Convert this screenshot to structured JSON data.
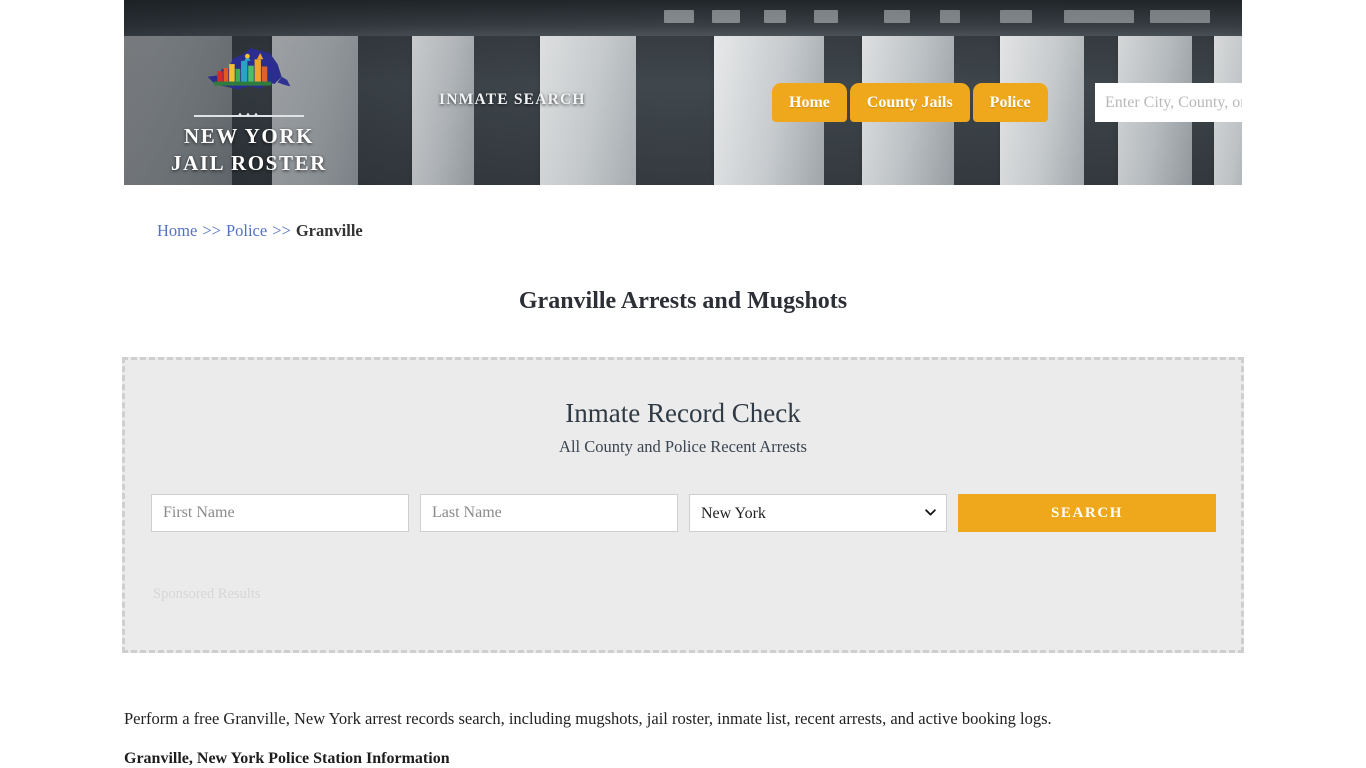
{
  "header": {
    "logo_line1": "NEW YORK",
    "logo_line2": "JAIL ROSTER",
    "logo_icon": "new-york-state-skyline-logo",
    "tagline": "INMATE SEARCH",
    "nav": [
      {
        "label": "Home"
      },
      {
        "label": "County Jails"
      },
      {
        "label": "Police"
      }
    ],
    "search": {
      "placeholder": "Enter City, County, or Facility",
      "value": "",
      "button_icon": "search-icon"
    },
    "accent_color": "#efa81c"
  },
  "breadcrumb": {
    "items": [
      {
        "label": "Home",
        "link": true
      },
      {
        "label": "Police",
        "link": true
      },
      {
        "label": "Granville",
        "link": false
      }
    ],
    "separator": ">>",
    "link_color": "#5472c4"
  },
  "page": {
    "title": "Granville Arrests and Mugshots"
  },
  "record_check": {
    "title": "Inmate Record Check",
    "subtitle": "All County and Police Recent Arrests",
    "first_name_placeholder": "First Name",
    "first_name_value": "",
    "last_name_placeholder": "Last Name",
    "last_name_value": "",
    "state_selected": "New York",
    "state_options": [
      "New York"
    ],
    "search_label": "SEARCH",
    "sponsored_label": "Sponsored Results",
    "panel_bg": "#ebebeb",
    "border_color": "#cfcfcf"
  },
  "content": {
    "intro": "Perform a free Granville, New York arrest records search, including mugshots, jail roster, inmate list, recent arrests, and active booking logs.",
    "section_heading": "Granville, New York Police Station Information"
  }
}
